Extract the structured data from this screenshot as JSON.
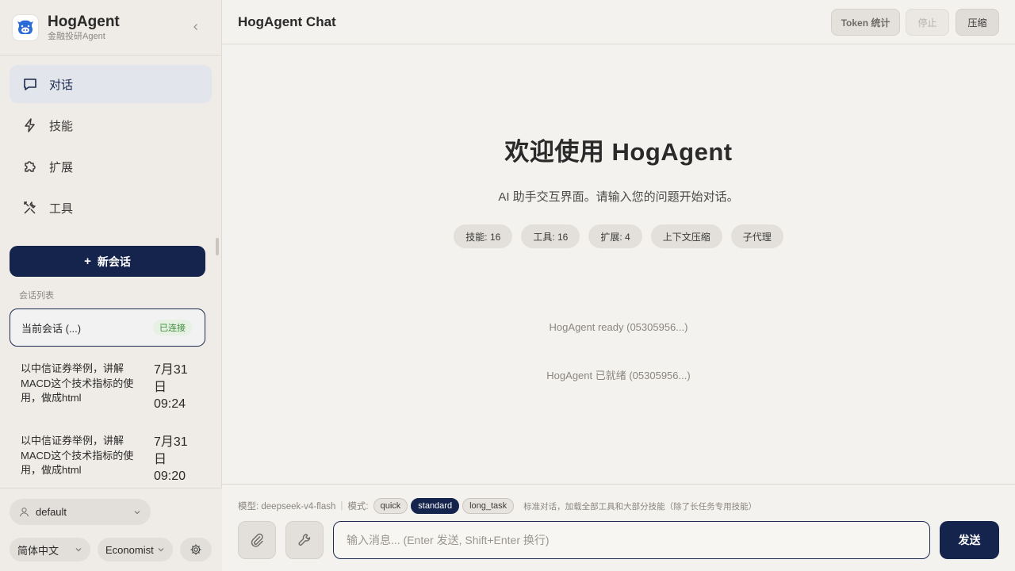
{
  "brand": {
    "name": "HogAgent",
    "subtitle": "金融投研Agent"
  },
  "nav": [
    {
      "label": "对话",
      "icon": "chat-icon",
      "active": true
    },
    {
      "label": "技能",
      "icon": "lightning-icon",
      "active": false
    },
    {
      "label": "扩展",
      "icon": "puzzle-icon",
      "active": false
    },
    {
      "label": "工具",
      "icon": "tools-icon",
      "active": false
    }
  ],
  "new_chat": {
    "plus": "+",
    "label": "新会话"
  },
  "sessions": {
    "label": "会话列表",
    "current": {
      "title": "当前会话 (...)",
      "badge": "已连接"
    },
    "items": [
      {
        "title": "以中信证券举例，讲解MACD这个技术指标的使用，做成html",
        "date": "7月31日 09:24"
      },
      {
        "title": "以中信证券举例，讲解MACD这个技术指标的使用，做成html",
        "date": "7月31日 09:20"
      }
    ]
  },
  "footer": {
    "user": "default",
    "language": "简体中文",
    "persona": "Economist"
  },
  "topbar": {
    "title": "HogAgent Chat",
    "token_label": "Token 统计",
    "stop_label": "停止",
    "compress_label": "压缩"
  },
  "welcome": {
    "title": "欢迎使用 HogAgent",
    "subtitle": "AI 助手交互界面。请输入您的问题开始对话。",
    "chips": [
      "技能: 16",
      "工具: 16",
      "扩展: 4",
      "上下文压缩",
      "子代理"
    ]
  },
  "system_messages": [
    "HogAgent ready (05305956...)",
    "HogAgent 已就绪 (05305956...)"
  ],
  "composer": {
    "model_label": "模型: deepseek-v4-flash",
    "separator": "|",
    "mode_label": "模式:",
    "modes": [
      "quick",
      "standard",
      "long_task"
    ],
    "selected_mode": "standard",
    "mode_desc": "标准对话，加载全部工具和大部分技能（除了长任务专用技能）",
    "placeholder": "输入消息... (Enter 发送, Shift+Enter 换行)",
    "send_label": "发送"
  },
  "colors": {
    "accent": "#15244d",
    "background": "#f4f2ee",
    "sidebar": "#efece7",
    "connected": "#3d8a3a"
  }
}
